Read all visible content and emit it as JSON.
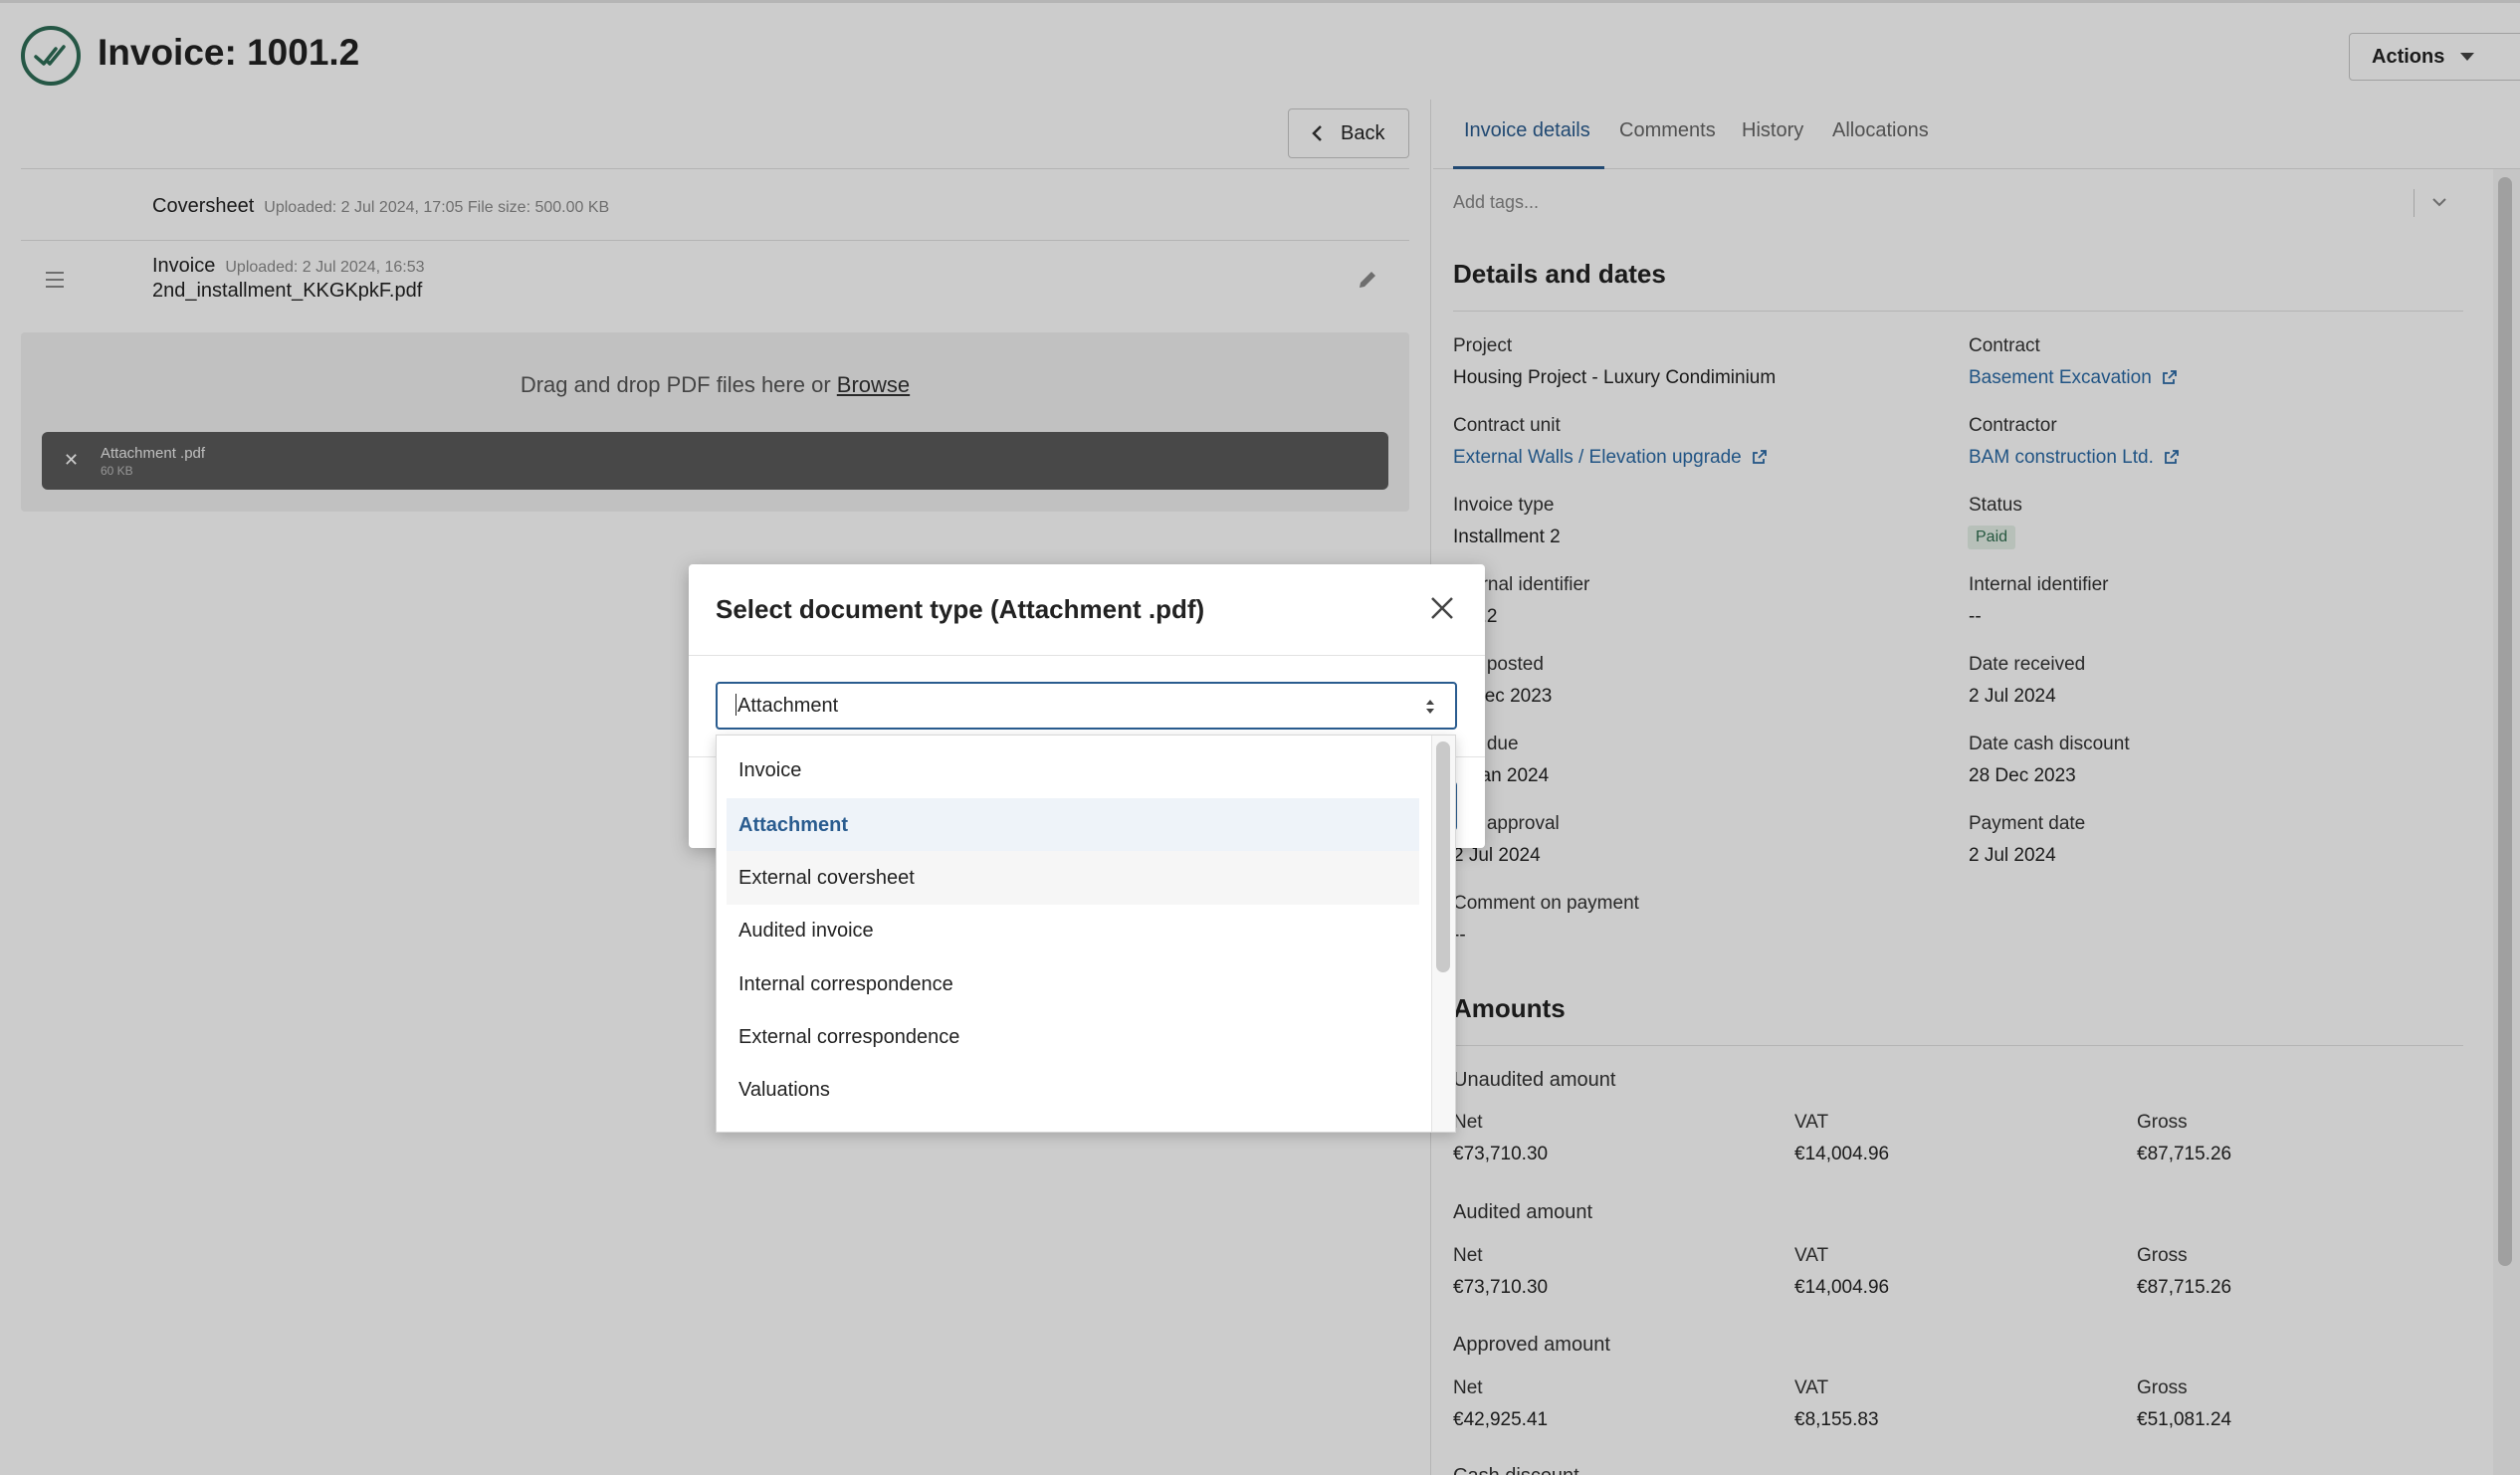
{
  "header": {
    "title": "Invoice: 1001.2",
    "actions_label": "Actions"
  },
  "left": {
    "back_label": "Back",
    "documents": [
      {
        "name": "Coversheet",
        "meta": "Uploaded: 2 Jul 2024, 17:05 File size: 500.00 KB"
      },
      {
        "name": "Invoice",
        "meta": "Uploaded: 2 Jul 2024, 16:53",
        "file": "2nd_installment_KKGKpkF.pdf"
      }
    ],
    "dropzone": {
      "text": "Drag and drop PDF files here or",
      "browse": "Browse",
      "attachment_name": "Attachment .pdf",
      "attachment_size": "60 KB"
    }
  },
  "tabs": [
    "Invoice details",
    "Comments",
    "History",
    "Allocations"
  ],
  "tags_placeholder": "Add tags...",
  "details": {
    "title": "Details and dates",
    "fields": {
      "project": {
        "label": "Project",
        "value": "Housing Project - Luxury Condiminium"
      },
      "contract": {
        "label": "Contract",
        "value": "Basement Excavation"
      },
      "contract_unit": {
        "label": "Contract unit",
        "value": "External Walls / Elevation upgrade"
      },
      "contractor": {
        "label": "Contractor",
        "value": "BAM construction Ltd."
      },
      "invoice_type": {
        "label": "Invoice type",
        "value": "Installment 2"
      },
      "status": {
        "label": "Status",
        "value": "Paid"
      },
      "ext_identifier": {
        "label": "ernal identifier",
        "value": "1.2"
      },
      "int_identifier": {
        "label": "Internal identifier",
        "value": "--"
      },
      "date_posted": {
        "label": "e posted",
        "value": "Dec 2023"
      },
      "date_received": {
        "label": "Date received",
        "value": "2 Jul 2024"
      },
      "date_due": {
        "label": "e due",
        "value": "Jan 2024"
      },
      "date_cash_discount": {
        "label": "Date cash discount",
        "value": "28 Dec 2023"
      },
      "date_approval": {
        "label": "e approval",
        "value": "2 Jul 2024"
      },
      "payment_date": {
        "label": "Payment date",
        "value": "2 Jul 2024"
      },
      "comment": {
        "label": "Comment on payment",
        "value": "--"
      }
    }
  },
  "amounts": {
    "title": "Amounts",
    "col_labels": {
      "net": "Net",
      "vat": "VAT",
      "gross": "Gross"
    },
    "groups": [
      {
        "title": "Unaudited amount",
        "net": "€73,710.30",
        "vat": "€14,004.96",
        "gross": "€87,715.26"
      },
      {
        "title": "Audited amount",
        "net": "€73,710.30",
        "vat": "€14,004.96",
        "gross": "€87,715.26"
      },
      {
        "title": "Approved amount",
        "net": "€42,925.41",
        "vat": "€8,155.83",
        "gross": "€51,081.24"
      }
    ],
    "next_title": "Cash discount"
  },
  "modal": {
    "title": "Select document type (Attachment .pdf)",
    "select_value": "Attachment",
    "options": [
      "Invoice",
      "Attachment",
      "External coversheet",
      "Audited invoice",
      "Internal correspondence",
      "External correspondence",
      "Valuations"
    ],
    "selected_index": 1,
    "hover_index": 2
  },
  "colors": {
    "brand": "#2f6d57",
    "accent": "#2a5c8f",
    "link": "#2a6aa6"
  }
}
